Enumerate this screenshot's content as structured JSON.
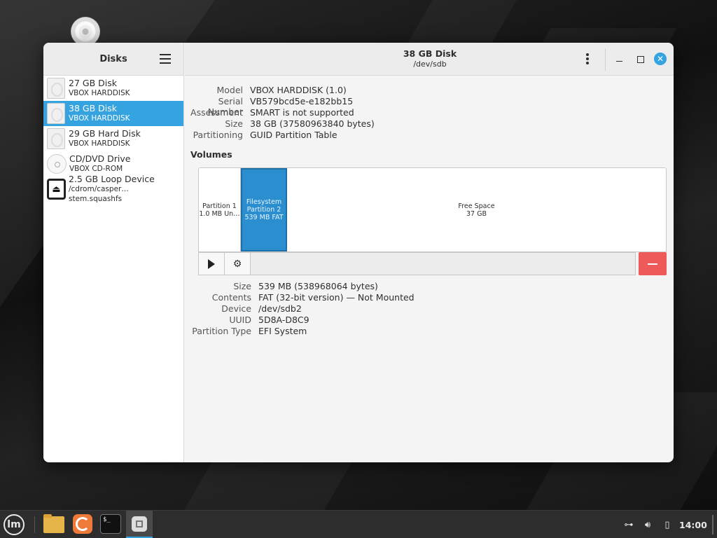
{
  "window": {
    "sidebar_title": "Disks",
    "title": "38 GB Disk",
    "subtitle": "/dev/sdb"
  },
  "disks": [
    {
      "name": "27 GB Disk",
      "sub": "VBOX HARDDISK",
      "icon": "harddisk-icon",
      "selected": false
    },
    {
      "name": "38 GB Disk",
      "sub": "VBOX HARDDISK",
      "icon": "harddisk-icon",
      "selected": true
    },
    {
      "name": "29 GB Hard Disk",
      "sub": "VBOX HARDDISK",
      "icon": "harddisk-icon",
      "selected": false
    },
    {
      "name": "CD/DVD Drive",
      "sub": "VBOX CD-ROM",
      "icon": "optical-disc-icon",
      "selected": false
    },
    {
      "name": "2.5 GB Loop Device",
      "sub": "/cdrom/casper… stem.squashfs",
      "icon": "eject-icon",
      "selected": false
    }
  ],
  "disk_info": [
    {
      "label": "Model",
      "value": "VBOX HARDDISK (1.0)"
    },
    {
      "label": "Serial Number",
      "value": "VB579bcd5e-e182bb15"
    },
    {
      "label": "Assessment",
      "value": "SMART is not supported"
    },
    {
      "label": "Size",
      "value": "38 GB (37580963840 bytes)"
    },
    {
      "label": "Partitioning",
      "value": "GUID Partition Table"
    }
  ],
  "volumes_title": "Volumes",
  "volumes": [
    {
      "line1": "Partition 1",
      "line2": "1.0 MB Un…",
      "line3": ""
    },
    {
      "line1": "Filesystem",
      "line2": "Partition 2",
      "line3": "539 MB FAT"
    },
    {
      "line1": "Free Space",
      "line2": "37 GB",
      "line3": ""
    }
  ],
  "partition_info": [
    {
      "label": "Size",
      "value": "539 MB (538968064 bytes)"
    },
    {
      "label": "Contents",
      "value": "FAT (32-bit version) — Not Mounted"
    },
    {
      "label": "Device",
      "value": "/dev/sdb2"
    },
    {
      "label": "UUID",
      "value": "5D8A-D8C9"
    },
    {
      "label": "Partition Type",
      "value": "EFI System"
    }
  ],
  "taskbar": {
    "clock": "14:00",
    "terminal_glyph": "$_",
    "mint_glyph": "lm"
  },
  "colors": {
    "accent": "#35a3e0",
    "selected_partition": "#2b8fcf",
    "delete": "#ee5a5a"
  }
}
